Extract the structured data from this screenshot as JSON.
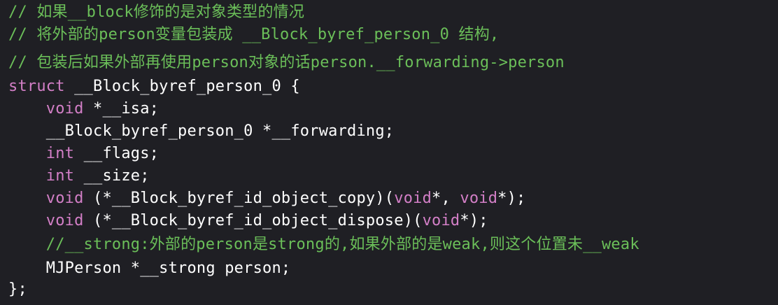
{
  "code": {
    "language": "c",
    "lines": [
      {
        "segments": [
          {
            "t": "comment",
            "text": "// 如果__block修饰的是对象类型的情况"
          }
        ]
      },
      {
        "segments": [
          {
            "t": "comment",
            "text": "// 将外部的person变量包装成 __Block_byref_person_0 结构,"
          }
        ]
      },
      {
        "segments": [
          {
            "t": "comment",
            "text": "// 包装后如果外部再使用person对象的话person.__forwarding->person"
          }
        ]
      },
      {
        "segments": [
          {
            "t": "keyword",
            "text": "struct"
          },
          {
            "t": "plain",
            "text": " __Block_byref_person_0 {"
          }
        ]
      },
      {
        "segments": [
          {
            "t": "plain",
            "text": "    "
          },
          {
            "t": "keyword",
            "text": "void"
          },
          {
            "t": "plain",
            "text": " *__isa;"
          }
        ]
      },
      {
        "segments": [
          {
            "t": "plain",
            "text": "    __Block_byref_person_0 *__forwarding;"
          }
        ]
      },
      {
        "segments": [
          {
            "t": "plain",
            "text": "    "
          },
          {
            "t": "keyword",
            "text": "int"
          },
          {
            "t": "plain",
            "text": " __flags;"
          }
        ]
      },
      {
        "segments": [
          {
            "t": "plain",
            "text": "    "
          },
          {
            "t": "keyword",
            "text": "int"
          },
          {
            "t": "plain",
            "text": " __size;"
          }
        ]
      },
      {
        "segments": [
          {
            "t": "plain",
            "text": "    "
          },
          {
            "t": "keyword",
            "text": "void"
          },
          {
            "t": "plain",
            "text": " (*__Block_byref_id_object_copy)("
          },
          {
            "t": "keyword",
            "text": "void"
          },
          {
            "t": "plain",
            "text": "*, "
          },
          {
            "t": "keyword",
            "text": "void"
          },
          {
            "t": "plain",
            "text": "*);"
          }
        ]
      },
      {
        "segments": [
          {
            "t": "plain",
            "text": "    "
          },
          {
            "t": "keyword",
            "text": "void"
          },
          {
            "t": "plain",
            "text": " (*__Block_byref_id_object_dispose)("
          },
          {
            "t": "keyword",
            "text": "void"
          },
          {
            "t": "plain",
            "text": "*);"
          }
        ]
      },
      {
        "segments": [
          {
            "t": "plain",
            "text": "    "
          },
          {
            "t": "comment",
            "text": "//__strong:外部的person是strong的,如果外部的是weak,则这个位置未__weak"
          }
        ]
      },
      {
        "segments": [
          {
            "t": "plain",
            "text": "    MJPerson *__strong person;"
          }
        ]
      },
      {
        "segments": [
          {
            "t": "plain",
            "text": "};"
          }
        ]
      }
    ]
  },
  "theme": {
    "background": "#1f1f24",
    "comment": "#6bbf59",
    "keyword": "#d37fc7",
    "plain": "#ffffff"
  }
}
